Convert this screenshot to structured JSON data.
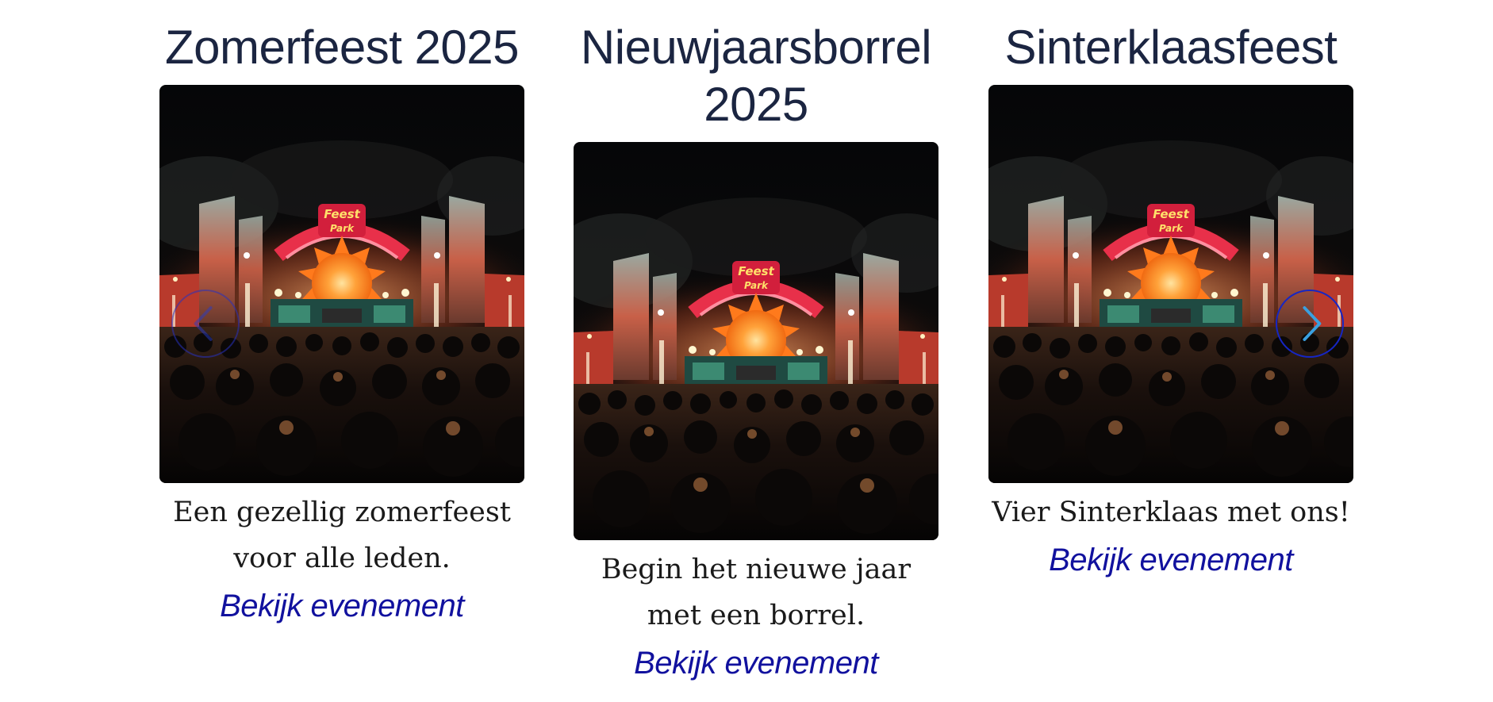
{
  "events": [
    {
      "title": "Zomerfeest 2025",
      "description": "Een gezellig zomerfeest voor alle leden.",
      "link_label": "Bekijk evenement"
    },
    {
      "title": "Nieuwjaarsborrel 2025",
      "description": "Begin het nieuwe jaar met een borrel.",
      "link_label": "Bekijk evenement"
    },
    {
      "title": "Sinterklaasfeest",
      "description": "Vier Sinterklaas met ons!",
      "link_label": "Bekijk evenement"
    }
  ],
  "stage_sign": {
    "line1": "Feest",
    "line2": "Park"
  },
  "navigation": {
    "prev_icon": "chevron-left-icon",
    "next_icon": "chevron-right-icon"
  },
  "colors": {
    "title": "#1b2541",
    "link": "#11119e",
    "nav_border": "#1626c4",
    "nav_chevron": "#3aa0e0"
  }
}
